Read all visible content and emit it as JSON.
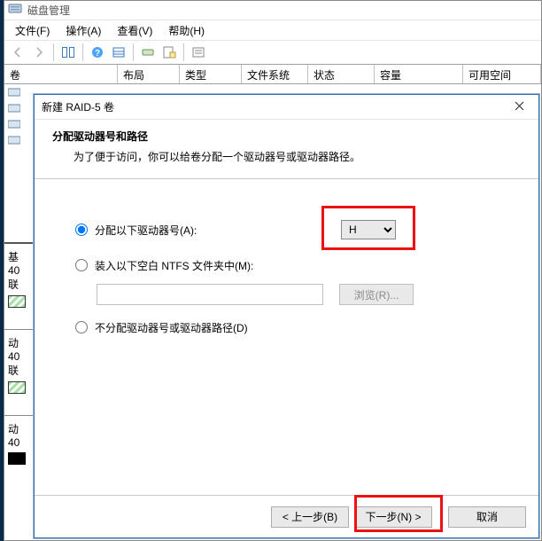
{
  "main_window": {
    "title": "磁盘管理",
    "menu": {
      "file": "文件(F)",
      "action": "操作(A)",
      "view": "查看(V)",
      "help": "帮助(H)"
    },
    "columns": {
      "volume": "卷",
      "layout": "布局",
      "type": "类型",
      "filesystem": "文件系统",
      "status": "状态",
      "capacity": "容量",
      "free": "可用空间"
    },
    "strip": {
      "basic": "基",
      "size": "40",
      "online": "联",
      "dynamic": "动"
    }
  },
  "wizard": {
    "title": "新建 RAID-5 卷",
    "heading": "分配驱动器号和路径",
    "sub": "为了便于访问，你可以给卷分配一个驱动器号或驱动器路径。",
    "opt1": "分配以下驱动器号(A):",
    "drive_letter": "H",
    "opt2": "装入以下空白 NTFS 文件夹中(M):",
    "browse": "浏览(R)...",
    "opt3": "不分配驱动器号或驱动器路径(D)",
    "back": "< 上一步(B)",
    "next": "下一步(N) >",
    "cancel": "取消"
  }
}
